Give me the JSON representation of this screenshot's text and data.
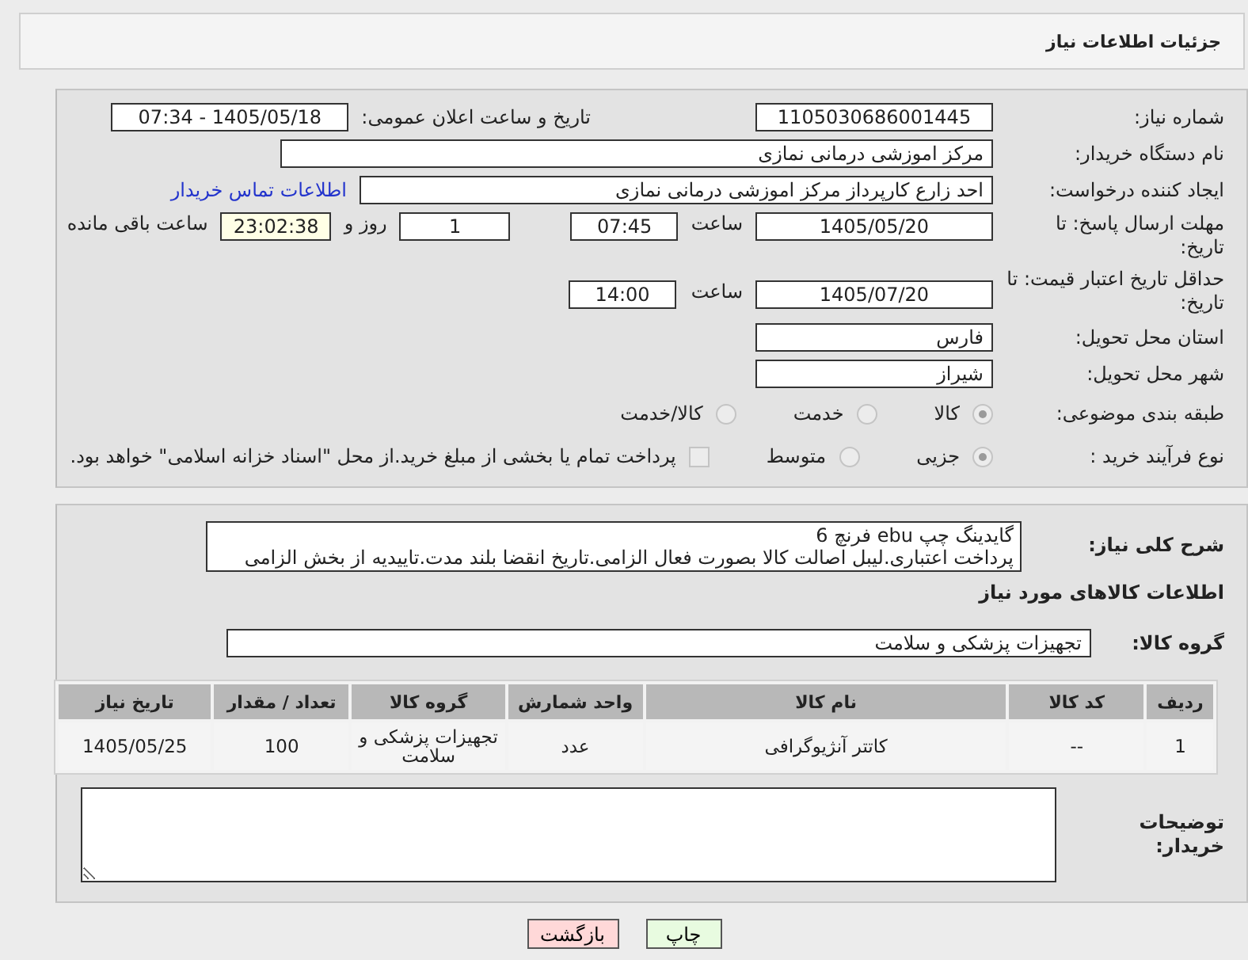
{
  "header": {
    "title": "جزئیات اطلاعات نیاز"
  },
  "need_number": {
    "label": "شماره نیاز:",
    "value": "1105030686001445"
  },
  "announcement": {
    "label": "تاریخ و ساعت اعلان عمومی:",
    "value": "1405/05/18 - 07:34"
  },
  "buyer_org": {
    "label": "نام دستگاه خریدار:",
    "value": "مرکز اموزشی درمانی نمازی"
  },
  "requester": {
    "label": "ایجاد کننده درخواست:",
    "value": "احد زارع کارپرداز مرکز اموزشی درمانی نمازی",
    "link": "اطلاعات تماس خریدار"
  },
  "reply_deadline": {
    "label": "مهلت ارسال پاسخ: تا تاریخ:",
    "date": "1405/05/20",
    "time_label": "ساعت",
    "time": "07:45",
    "days": "1",
    "days_label": "روز و",
    "remaining": "23:02:38",
    "remaining_label": "ساعت باقی مانده"
  },
  "price_validity": {
    "label": "حداقل تاریخ اعتبار قیمت: تا تاریخ:",
    "date": "1405/07/20",
    "time_label": "ساعت",
    "time": "14:00"
  },
  "province": {
    "label": "استان محل تحویل:",
    "value": "فارس"
  },
  "city": {
    "label": "شهر محل تحویل:",
    "value": "شیراز"
  },
  "category": {
    "label": "طبقه بندی موضوعی:",
    "options": [
      {
        "label": "کالا",
        "selected": true
      },
      {
        "label": "خدمت",
        "selected": false
      },
      {
        "label": "کالا/خدمت",
        "selected": false
      }
    ]
  },
  "purchase_process": {
    "label": "نوع فرآیند خرید :",
    "options": [
      {
        "label": "جزیی",
        "selected": true
      },
      {
        "label": "متوسط",
        "selected": false
      }
    ],
    "treasury": {
      "label": "پرداخت تمام یا بخشی از مبلغ خرید.از محل \"اسناد خزانه اسلامی\" خواهد بود.",
      "checked": false
    }
  },
  "description": {
    "label": "شرح کلی نیاز:",
    "lines": [
      "گایدینگ چپ ebu فرنچ 6",
      "پرداخت اعتباری.لیبل اصالت کالا بصورت فعال الزامی.تاریخ انقضا بلند مدت.تاییدیه از بخش الزامی"
    ]
  },
  "goods_heading": "اطلاعات کالاهای مورد نیاز",
  "goods_group": {
    "label": "گروه کالا:",
    "value": "تجهیزات پزشکی و سلامت"
  },
  "table": {
    "columns": [
      "ردیف",
      "کد کالا",
      "نام کالا",
      "واحد شمارش",
      "گروه کالا",
      "تعداد / مقدار",
      "تاریخ نیاز"
    ],
    "rows": [
      [
        "1",
        "--",
        "کاتتر آنژیوگرافی",
        "عدد",
        "تجهیزات پزشکی و سلامت",
        "100",
        "1405/05/25"
      ]
    ]
  },
  "buyer_notes": {
    "label": "توضیحات خریدار:"
  },
  "buttons": [
    {
      "label": "چاپ",
      "kind": "print"
    },
    {
      "label": "بازگشت",
      "kind": "back"
    }
  ]
}
